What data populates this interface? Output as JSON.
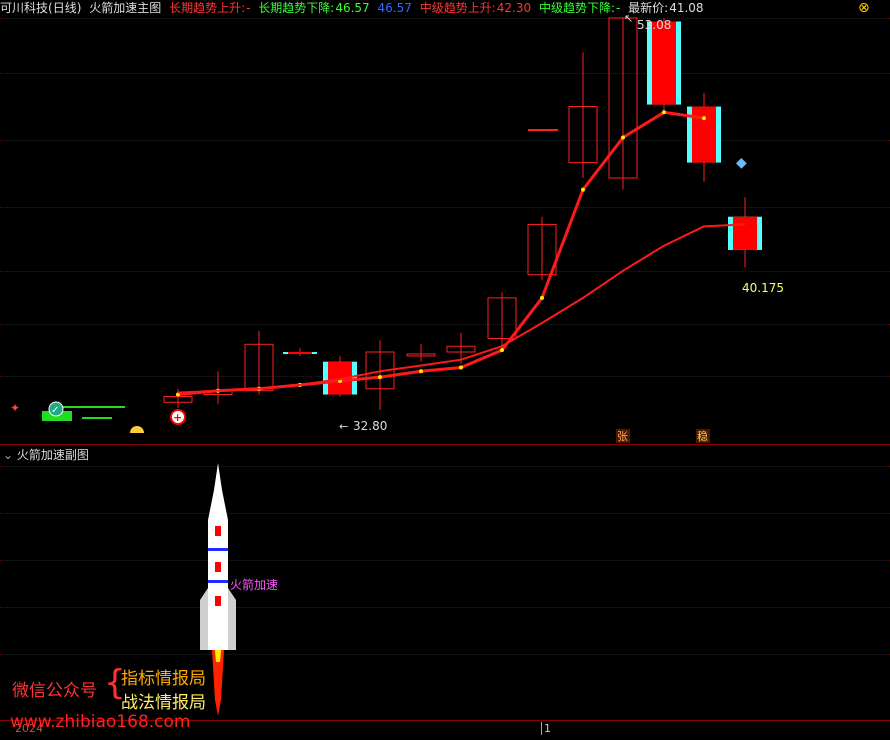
{
  "header": {
    "stock_name": "可川科技",
    "period": "(日线)",
    "indicator_name": "火箭加速主图",
    "long_up_label": "长期趋势上升:",
    "long_up_value": "-",
    "long_down_label": "长期趋势下降:",
    "long_down_value": "46.57",
    "blue_value": "46.57",
    "mid_up_label": "中级趋势上升:",
    "mid_up_value": "42.30",
    "mid_down_label": "中级趋势下降:",
    "mid_down_value": "-",
    "latest_label": "最新价:",
    "latest_value": "41.08",
    "close_icon": "close-x-icon"
  },
  "main_chart": {
    "high_label": "53.08",
    "low_label": "32.80",
    "last_label": "40.175",
    "badge_zhang": "张",
    "badge_wen": "稳"
  },
  "sub_chart": {
    "title": "火箭加速副图",
    "rocket_label": "火箭加速"
  },
  "overlay": {
    "wechat_label": "微信公众号",
    "brace": "{",
    "item1": "指标情报局",
    "item2": "战法情报局",
    "website": "www.zhibiao168.com",
    "year": "2024",
    "page_marker": "1"
  },
  "colors": {
    "up": "#ff2020",
    "down_fill": "#ff0000",
    "cyan": "#55ffff",
    "line": "#ff1a1a",
    "dot": "#ffee00",
    "green": "#22dd22"
  },
  "chart_data": {
    "type": "candlestick",
    "candles": [
      {
        "o": 33.2,
        "h": 33.9,
        "l": 32.9,
        "c": 33.5,
        "color": "up"
      },
      {
        "o": 33.6,
        "h": 34.8,
        "l": 33.1,
        "c": 33.8,
        "color": "up"
      },
      {
        "o": 33.8,
        "h": 36.9,
        "l": 33.6,
        "c": 36.2,
        "color": "up"
      },
      {
        "o": 35.8,
        "h": 36.0,
        "l": 35.6,
        "c": 35.7,
        "color": "down"
      },
      {
        "o": 35.3,
        "h": 35.6,
        "l": 33.5,
        "c": 33.6,
        "color": "down"
      },
      {
        "o": 33.9,
        "h": 36.4,
        "l": 32.8,
        "c": 35.8,
        "color": "up"
      },
      {
        "o": 35.7,
        "h": 36.2,
        "l": 35.3,
        "c": 35.6,
        "color": "up"
      },
      {
        "o": 35.8,
        "h": 36.8,
        "l": 35.2,
        "c": 36.1,
        "color": "up"
      },
      {
        "o": 36.5,
        "h": 38.9,
        "l": 35.8,
        "c": 38.6,
        "color": "up"
      },
      {
        "o": 39.8,
        "h": 42.8,
        "l": 39.5,
        "c": 42.4,
        "color": "up"
      },
      {
        "o": 45.6,
        "h": 51.3,
        "l": 44.8,
        "c": 48.5,
        "color": "up"
      },
      {
        "o": 44.8,
        "h": 53.08,
        "l": 44.2,
        "c": 53.08,
        "color": "up"
      },
      {
        "o": 52.9,
        "h": 53.08,
        "l": 48.2,
        "c": 48.6,
        "color": "down"
      },
      {
        "o": 48.5,
        "h": 49.2,
        "l": 44.6,
        "c": 45.6,
        "color": "down"
      },
      {
        "o": 42.8,
        "h": 43.8,
        "l": 40.175,
        "c": 41.08,
        "color": "down"
      }
    ],
    "series": [
      {
        "values": [
          33.6,
          33.8,
          33.9,
          34.1,
          34.3,
          34.5,
          34.8,
          35.0,
          35.9,
          38.6,
          44.2,
          46.9,
          48.2,
          47.9,
          null
        ]
      },
      {
        "values": [
          33.7,
          33.8,
          33.9,
          34.1,
          34.4,
          34.8,
          35.1,
          35.4,
          36.1,
          37.3,
          38.6,
          40.0,
          41.3,
          42.3,
          42.4
        ]
      }
    ]
  }
}
